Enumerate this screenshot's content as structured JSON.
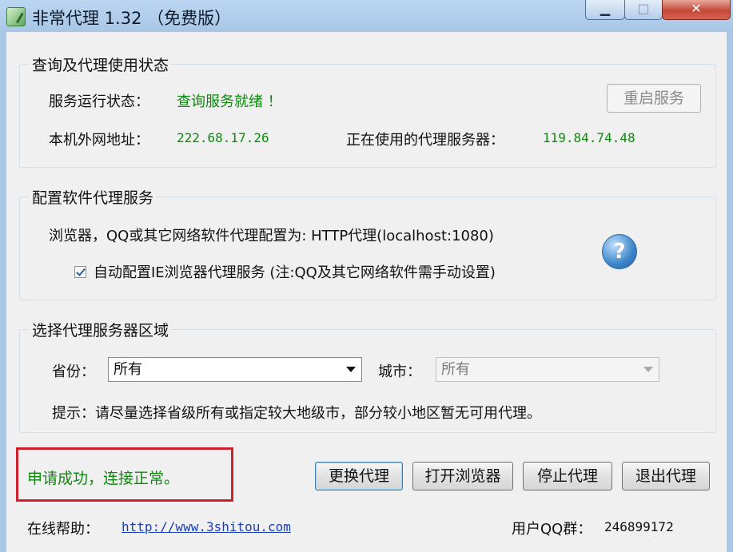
{
  "window": {
    "title": "非常代理 1.32 （免费版）",
    "controls": {
      "minimize": "▁",
      "maximize": "□",
      "close": "✕"
    }
  },
  "status_group": {
    "title": "查询及代理使用状态",
    "service_label": "服务运行状态：",
    "service_value": "查询服务就绪 ！",
    "restart_button": "重启服务",
    "ip_label": "本机外网地址：",
    "ip_value": "222.68.17.26",
    "proxy_label": "正在使用的代理服务器：",
    "proxy_value": "119.84.74.48"
  },
  "config_group": {
    "title": "配置软件代理服务",
    "description": "浏览器，QQ或其它网络软件代理配置为: HTTP代理(localhost:1080)",
    "auto_config_label": "自动配置IE浏览器代理服务 (注:QQ及其它网络软件需手动设置)",
    "auto_config_checked": true,
    "help_icon": "?"
  },
  "region_group": {
    "title": "选择代理服务器区域",
    "province_label": "省份：",
    "province_value": "所有",
    "city_label": "城市：",
    "city_value": "所有",
    "hint": "提示：请尽量选择省级所有或指定较大地级市，部分较小地区暂无可用代理。"
  },
  "footer": {
    "status_message": "申请成功，连接正常。",
    "buttons": {
      "switch_proxy": "更换代理",
      "open_browser": "打开浏览器",
      "stop_proxy": "停止代理",
      "exit_proxy": "退出代理"
    },
    "help_label": "在线帮助：",
    "help_url": "http://www.3shitou.com",
    "qq_group_label": "用户QQ群：",
    "qq_group_value": "246899172"
  },
  "colors": {
    "status_green": "#0c8a0c",
    "highlight_red": "#d0212a",
    "link_blue": "#1a3fb5"
  }
}
